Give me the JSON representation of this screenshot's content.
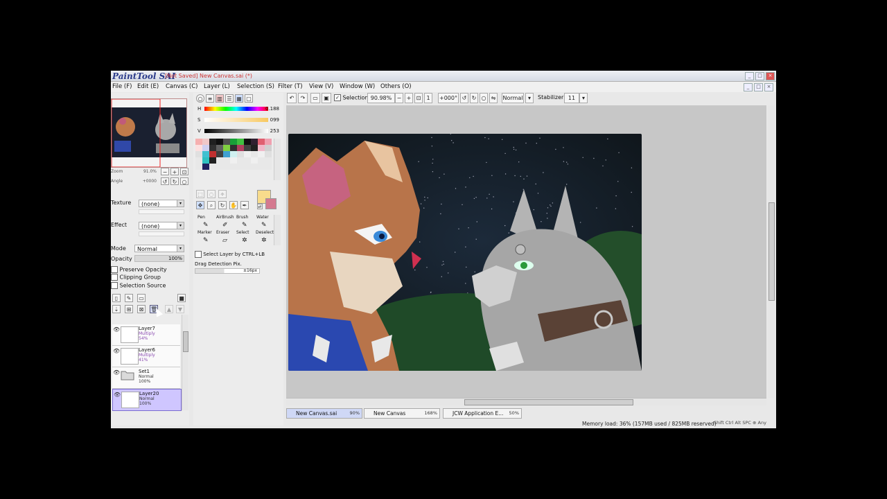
{
  "window": {
    "brand": "PaintTool SAI",
    "document_title": "[Not Saved] New Canvas.sai (*)",
    "buttons": [
      "_",
      "□",
      "×"
    ]
  },
  "menu": {
    "items": [
      "File (F)",
      "Edit (E)",
      "Canvas (C)",
      "Layer (L)",
      "Selection (S)",
      "Filter (T)",
      "View (V)",
      "Window (W)",
      "Others (O)"
    ]
  },
  "toolbar": {
    "selection_label": "Selection",
    "zoom": "90.98%",
    "rotation": "+000°",
    "blend_mode": "Normal",
    "stabilizer_label": "Stabilizer",
    "stabilizer_value": "11"
  },
  "navigator": {
    "zoom_label": "Zoom",
    "zoom_value": "91.0%",
    "angle_label": "Angle",
    "angle_value": "+0000"
  },
  "layer_props": {
    "texture_label": "Texture",
    "texture_value": "(none)",
    "effect_label": "Effect",
    "effect_value": "(none)",
    "mode_label": "Mode",
    "mode_value": "Normal",
    "opacity_label": "Opacity",
    "opacity_value": "100%",
    "preserve_opacity": "Preserve Opacity",
    "clipping_group": "Clipping Group",
    "selection_source": "Selection Source"
  },
  "layers": [
    {
      "name": "Layer7",
      "mode": "Multiply",
      "opacity": "54%"
    },
    {
      "name": "Layer6",
      "mode": "Multiply",
      "opacity": "41%"
    },
    {
      "name": "Set1",
      "mode": "Normal",
      "opacity": "100%"
    },
    {
      "name": "Layer20",
      "mode": "Normal",
      "opacity": "100%"
    }
  ],
  "color": {
    "h_label": "H",
    "h_value": "0.188",
    "s_label": "S",
    "s_value": "099",
    "v_label": "V",
    "v_value": "253",
    "current_color": "#f8dc8c",
    "secondary_color": "#d47a90"
  },
  "swatches": [
    "#f6b0b0",
    "#f0c8c8",
    "#202020",
    "#101010",
    "#505050",
    "#18a038",
    "#40c040",
    "#101010",
    "#302030",
    "#e06070",
    "#f0a0b0",
    "#fce0e0",
    "#d0d0f0",
    "#303030",
    "#606060",
    "#80d040",
    "#303030",
    "#b04060",
    "#404040",
    "#202020",
    "#f0b8c8",
    "#d0d0d0",
    "#e0e0e0",
    "#40c0d0",
    "#c03030",
    "#404040",
    "#40a0d0",
    "#d0f0f0",
    "#e0e0e0",
    "#f0f0f0",
    "#e8e8e8",
    "#f0f0f0",
    "#e0e0e0",
    "#e8e8e8",
    "#30c0c0",
    "#202020",
    "#e8e8e8",
    "#e8e8e8",
    "#f0f0f0",
    "#e8e8e8",
    "#e8e8e8",
    "#f0f0f0",
    "#e8e8e8",
    "#e8e8e8",
    "#e8e8e8",
    "#202060",
    "#e8e8e8",
    "#e8e8e8",
    "#e8e8e8",
    "#e8e8e8",
    "#e8e8e8",
    "#e8e8e8",
    "#e8e8e8",
    "#e8e8e8",
    "#e8e8e8"
  ],
  "tools": {
    "names": [
      "Pen",
      "AirBrush",
      "Brush",
      "Water",
      "Marker",
      "Eraser",
      "Select",
      "Deselect"
    ],
    "select_layer_label": "Select Layer by CTRL+LB",
    "drag_detection_label": "Drag Detection Pix.",
    "drag_detection_value": "±16px"
  },
  "tabs": [
    {
      "label": "New Canvas.sai",
      "percent": "90%"
    },
    {
      "label": "New Canvas",
      "percent": "168%"
    },
    {
      "label": "JCW Application E...",
      "percent": "50%"
    }
  ],
  "status": {
    "memory": "Memory load: 36% (157MB used / 825MB reserved)",
    "keys": "Shift Ctrl Alt SPC ⊕ Any"
  }
}
